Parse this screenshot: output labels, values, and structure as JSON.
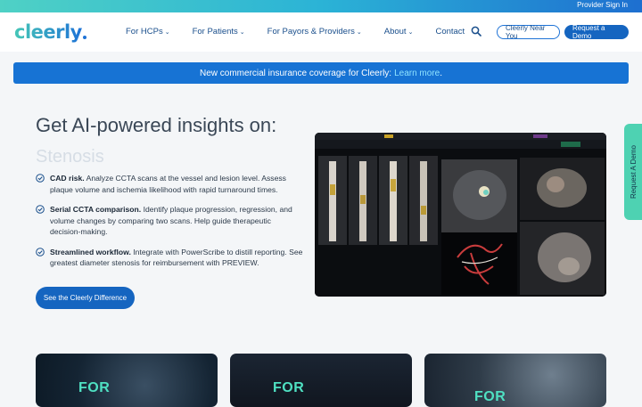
{
  "topbar": {
    "provider_signin": "Provider Sign In"
  },
  "brand": {
    "logo_text": "cleerly"
  },
  "nav": {
    "items": [
      {
        "label": "For HCPs",
        "has_dropdown": true
      },
      {
        "label": "For Patients",
        "has_dropdown": true
      },
      {
        "label": "For Payors & Providers",
        "has_dropdown": true
      },
      {
        "label": "About",
        "has_dropdown": true
      },
      {
        "label": "Contact",
        "has_dropdown": false
      }
    ],
    "search_icon": "search-icon",
    "near_you_label": "Cleerly Near You",
    "demo_label": "Request a Demo"
  },
  "banner": {
    "text": "New commercial insurance coverage for Cleerly:",
    "link": "Learn more",
    "suffix": "."
  },
  "hero": {
    "title": "Get AI-powered insights on:",
    "rotating_word": "Stenosis",
    "bullets": [
      {
        "bold": "CAD risk.",
        "text": " Analyze CCTA scans at the vessel and lesion level. Assess plaque volume and ischemia likelihood with rapid turnaround times."
      },
      {
        "bold": "Serial CCTA comparison.",
        "text": " Identify plaque progression, regression, and volume changes by comparing two scans. Help guide therapeutic decision-making."
      },
      {
        "bold": "Streamlined workflow.",
        "text": " Integrate with PowerScribe to distill reporting. See greatest diameter stenosis for reimbursement with PREVIEW."
      }
    ],
    "cta_label": "See the Cleerly Difference"
  },
  "side_tab": {
    "label": "Request A Demo"
  },
  "cards": [
    {
      "label": "FOR"
    },
    {
      "label": "FOR"
    },
    {
      "label": "FOR"
    }
  ],
  "colors": {
    "brand_blue": "#1565c0",
    "banner_blue": "#1773d4",
    "accent_teal": "#4ed2b2",
    "nav_text": "#1a4f8c"
  }
}
